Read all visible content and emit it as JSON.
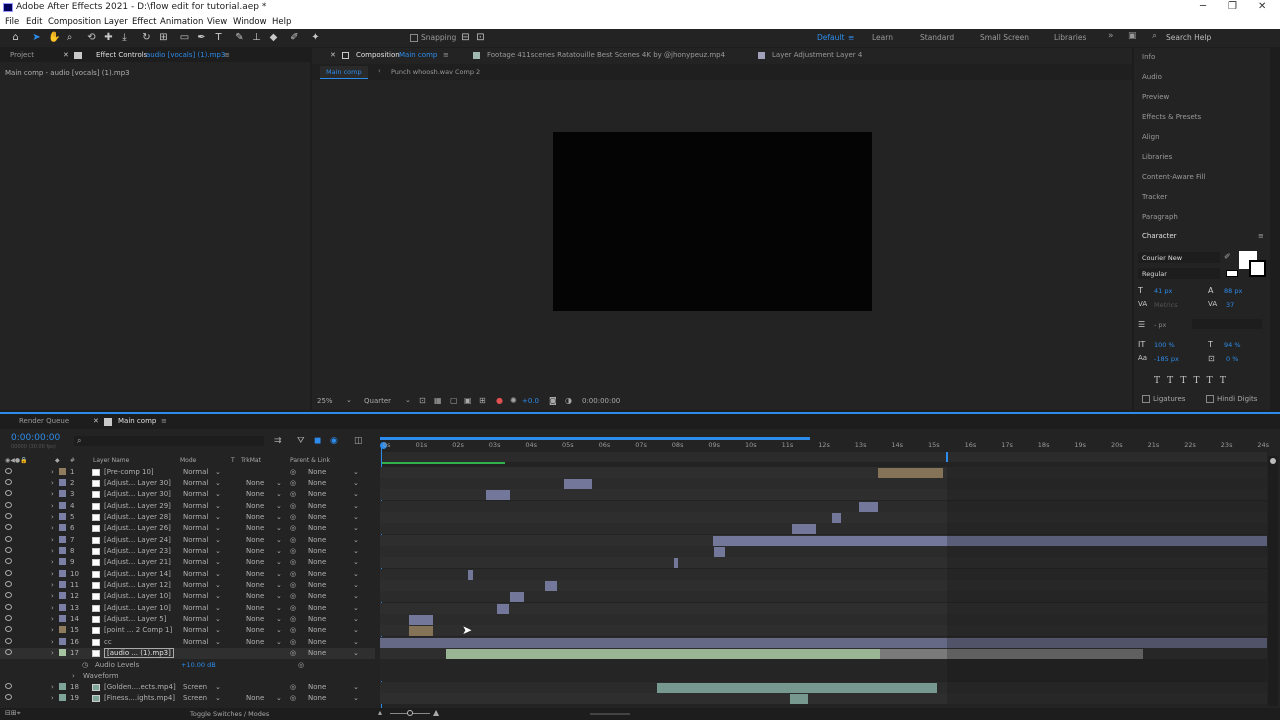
{
  "window": {
    "title": "Adobe After Effects 2021 - D:\\flow edit for tutorial.aep *"
  },
  "menu": [
    "File",
    "Edit",
    "Composition",
    "Layer",
    "Effect",
    "Animation",
    "View",
    "Window",
    "Help"
  ],
  "toolbar": {
    "snapping_label": "Snapping",
    "workspaces": [
      "Default",
      "Learn",
      "Standard",
      "Small Screen",
      "Libraries"
    ],
    "search_placeholder": "Search Help"
  },
  "project_panel": {
    "tab_project": "Project",
    "tab_effect_controls": "Effect Controls",
    "effect_controls_target": "audio [vocals] (1).mp3",
    "breadcrumb": "Main comp - audio [vocals] (1).mp3"
  },
  "composition_panel": {
    "tab_composition_label": "Composition",
    "tab_composition_name": "Main comp",
    "tab_footage": "Footage 411scenes Ratatouille Best Scenes 4K by @jhonypeuz.mp4",
    "tab_layer": "Layer Adjustment Layer 4",
    "subtab_main": "Main comp",
    "subtab_other": "Punch whoosh.wav Comp 2",
    "zoom": "25%",
    "resolution": "Quarter",
    "exposure": "+0.0",
    "timecode": "0:00:00:00"
  },
  "right_panel": {
    "items": [
      "Info",
      "Audio",
      "Preview",
      "Effects & Presets",
      "Align",
      "Libraries",
      "Content-Aware Fill",
      "Tracker",
      "Paragraph",
      "Character"
    ],
    "character": {
      "font": "Courier New",
      "style": "Regular",
      "size": "41 px",
      "leading": "88 px",
      "kerning": "Metrics",
      "tracking": "37",
      "stroke": "- px",
      "vscale": "100 %",
      "hscale": "94 %",
      "baseline": "-185 px",
      "tsume": "0 %",
      "ligatures": "Ligatures",
      "hindi_digits": "Hindi Digits"
    }
  },
  "timeline": {
    "tab_render_queue": "Render Queue",
    "tab_main_comp": "Main comp",
    "timecode": "0:00:00:00",
    "fps": "00000 (30.00 fps)",
    "headers": {
      "hash": "#",
      "name": "Layer Name",
      "mode": "Mode",
      "t": "T",
      "trkmat": "TrkMat",
      "parent": "Parent & Link"
    },
    "ruler": [
      "0s",
      "01s",
      "02s",
      "03s",
      "04s",
      "05s",
      "06s",
      "07s",
      "08s",
      "09s",
      "10s",
      "11s",
      "12s",
      "13s",
      "14s",
      "15s",
      "16s",
      "17s",
      "18s",
      "19s",
      "20s",
      "21s",
      "22s",
      "23s",
      "24s"
    ],
    "layers": [
      {
        "num": "1",
        "name": "[Pre-comp 10]",
        "mode": "Normal",
        "trkmat": "",
        "parent": "None",
        "color": "#8f7b5d"
      },
      {
        "num": "2",
        "name": "[Adjust... Layer 30]",
        "mode": "Normal",
        "trkmat": "None",
        "parent": "None",
        "color": "#7b7fa6"
      },
      {
        "num": "3",
        "name": "[Adjust... Layer 30]",
        "mode": "Normal",
        "trkmat": "None",
        "parent": "None",
        "color": "#7b7fa6"
      },
      {
        "num": "4",
        "name": "[Adjust... Layer 29]",
        "mode": "Normal",
        "trkmat": "None",
        "parent": "None",
        "color": "#7b7fa6"
      },
      {
        "num": "5",
        "name": "[Adjust... Layer 28]",
        "mode": "Normal",
        "trkmat": "None",
        "parent": "None",
        "color": "#7b7fa6"
      },
      {
        "num": "6",
        "name": "[Adjust... Layer 26]",
        "mode": "Normal",
        "trkmat": "None",
        "parent": "None",
        "color": "#7b7fa6"
      },
      {
        "num": "7",
        "name": "[Adjust... Layer 24]",
        "mode": "Normal",
        "trkmat": "None",
        "parent": "None",
        "color": "#7b7fa6"
      },
      {
        "num": "8",
        "name": "[Adjust... Layer 23]",
        "mode": "Normal",
        "trkmat": "None",
        "parent": "None",
        "color": "#7b7fa6"
      },
      {
        "num": "9",
        "name": "[Adjust... Layer 21]",
        "mode": "Normal",
        "trkmat": "None",
        "parent": "None",
        "color": "#7b7fa6"
      },
      {
        "num": "10",
        "name": "[Adjust... Layer 14]",
        "mode": "Normal",
        "trkmat": "None",
        "parent": "None",
        "color": "#7b7fa6"
      },
      {
        "num": "11",
        "name": "[Adjust... Layer 12]",
        "mode": "Normal",
        "trkmat": "None",
        "parent": "None",
        "color": "#7b7fa6"
      },
      {
        "num": "12",
        "name": "[Adjust... Layer 10]",
        "mode": "Normal",
        "trkmat": "None",
        "parent": "None",
        "color": "#7b7fa6"
      },
      {
        "num": "13",
        "name": "[Adjust... Layer 10]",
        "mode": "Normal",
        "trkmat": "None",
        "parent": "None",
        "color": "#7b7fa6"
      },
      {
        "num": "14",
        "name": "[Adjust... Layer 5]",
        "mode": "Normal",
        "trkmat": "None",
        "parent": "None",
        "color": "#7b7fa6"
      },
      {
        "num": "15",
        "name": "[point ... 2 Comp 1]",
        "mode": "Normal",
        "trkmat": "None",
        "parent": "None",
        "color": "#8f7b5d"
      },
      {
        "num": "16",
        "name": "cc",
        "mode": "Normal",
        "trkmat": "None",
        "parent": "None",
        "color": "#7b7fa6"
      },
      {
        "num": "17",
        "name": "[audio ... (1).mp3]",
        "mode": "",
        "trkmat": "",
        "parent": "None",
        "color": "#a6c4a0"
      },
      {
        "num": "18",
        "name": "[Golden....ects.mp4]",
        "mode": "Screen",
        "trkmat": "",
        "parent": "None",
        "color": "#7fa49a"
      },
      {
        "num": "19",
        "name": "[Finess....ights.mp4]",
        "mode": "Screen",
        "trkmat": "None",
        "parent": "None",
        "color": "#7fa49a"
      }
    ],
    "audio_levels_label": "Audio Levels",
    "audio_levels_value": "+10.00 dB",
    "waveform_label": "Waveform",
    "toggle_label": "Toggle Switches / Modes"
  }
}
